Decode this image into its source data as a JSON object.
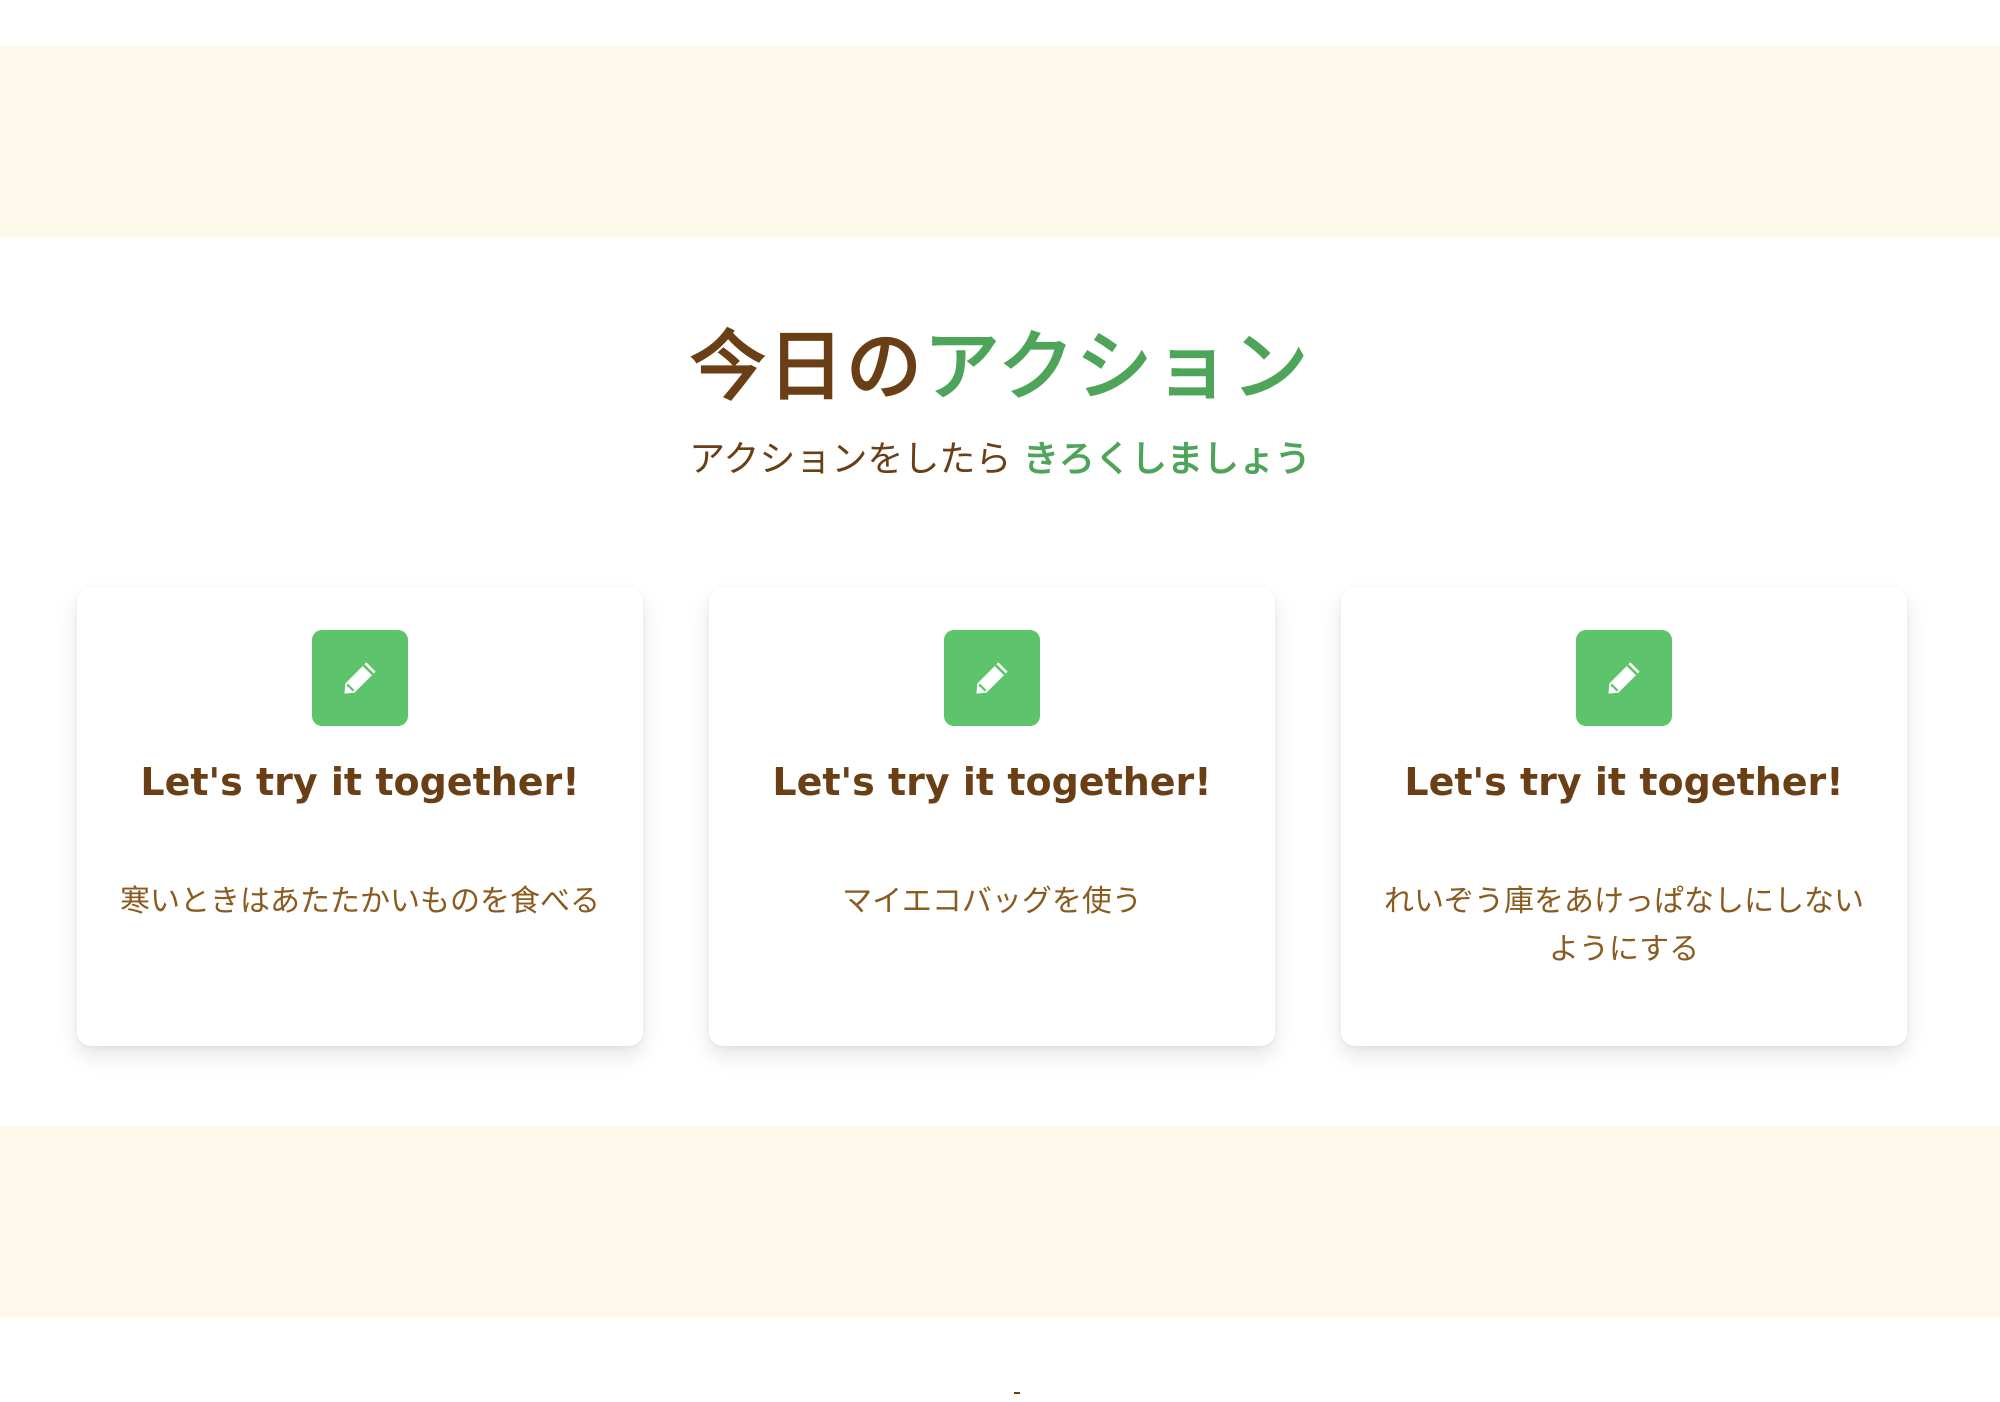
{
  "section": {
    "title_main": "今日の",
    "title_accent": "アクション",
    "subtitle_main": "アクションをしたら ",
    "subtitle_accent": "きろくしましょう"
  },
  "cards": [
    {
      "icon": "pencil-icon",
      "title": "Let's try it together!",
      "text": "寒いときはあたたかいものを食べる"
    },
    {
      "icon": "pencil-icon",
      "title": "Let's try it together!",
      "text": "マイエコバッグを使う"
    },
    {
      "icon": "pencil-icon",
      "title": "Let's try it together!",
      "text": "れいぞう庫をあけっぱなしにしないようにする"
    }
  ],
  "colors": {
    "brown": "#6b3f16",
    "green": "#4ea55a",
    "icon_green": "#5ec46c",
    "band": "#fdf9ea",
    "body_text": "#8a5a1e"
  }
}
